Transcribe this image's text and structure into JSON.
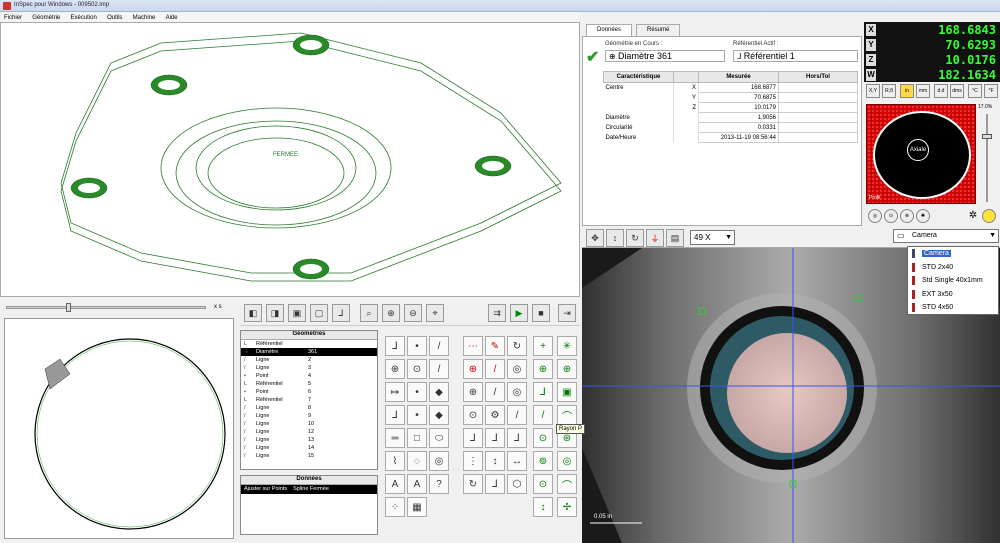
{
  "window": {
    "title": "InSpec pour Windows - 009502.imp"
  },
  "menu": [
    "Fichier",
    "Géométrie",
    "Exécution",
    "Outils",
    "Machine",
    "Aide"
  ],
  "cad": {
    "label": "FERMEE"
  },
  "profile_toolbar": {
    "scale_label": "x s"
  },
  "geometries": {
    "header": "Géométries",
    "rows": [
      {
        "icon": "L",
        "name": "Référentiel",
        "num": ""
      },
      {
        "icon": "⊕",
        "name": "Diamètre",
        "num": "361",
        "selected": true
      },
      {
        "icon": "/",
        "name": "Ligne",
        "num": "2"
      },
      {
        "icon": "/",
        "name": "Ligne",
        "num": "3"
      },
      {
        "icon": "•",
        "name": "Point",
        "num": "4"
      },
      {
        "icon": "L",
        "name": "Référentiel",
        "num": "5"
      },
      {
        "icon": "•",
        "name": "Point",
        "num": "6"
      },
      {
        "icon": "L",
        "name": "Référentiel",
        "num": "7"
      },
      {
        "icon": "/",
        "name": "Ligne",
        "num": "8"
      },
      {
        "icon": "/",
        "name": "Ligne",
        "num": "9"
      },
      {
        "icon": "/",
        "name": "Ligne",
        "num": "10"
      },
      {
        "icon": "/",
        "name": "Ligne",
        "num": "12"
      },
      {
        "icon": "/",
        "name": "Ligne",
        "num": "13"
      },
      {
        "icon": "/",
        "name": "Ligne",
        "num": "14"
      },
      {
        "icon": "/",
        "name": "Ligne",
        "num": "15"
      }
    ]
  },
  "donnees": {
    "header": "Données",
    "item1": "Ajuster sur Points",
    "item2": "Spline Fermée"
  },
  "tabs": [
    "Données",
    "Résumé"
  ],
  "data_panel": {
    "geom_label": "Géométrie en Cours :",
    "geom_value": "Diamètre 361",
    "ref_label": "Référentiel Actif :",
    "ref_value": "Référentiel 1",
    "columns": [
      "Caractéristique",
      "Mesurée",
      "Hors/Tol"
    ],
    "rows": [
      {
        "name": "Centre",
        "axis": "X",
        "value": "168.6877"
      },
      {
        "name": "",
        "axis": "Y",
        "value": "70.6875"
      },
      {
        "name": "",
        "axis": "Z",
        "value": "10.0179"
      },
      {
        "name": "Diamètre",
        "axis": "",
        "value": "1.9056"
      },
      {
        "name": "Circularité",
        "axis": "",
        "value": "0.0331"
      },
      {
        "name": "Date/Heure",
        "axis": "",
        "value": "2013-11-19 08:56:44"
      }
    ]
  },
  "dro": [
    {
      "axis": "X",
      "value": "168.6843"
    },
    {
      "axis": "Y",
      "value": "70.6293"
    },
    {
      "axis": "Z",
      "value": "10.0176"
    },
    {
      "axis": "W",
      "value": "182.1634"
    }
  ],
  "dro_tools": [
    "X,Y",
    "R,θ",
    "in",
    "mm",
    "d.d",
    "dms",
    "°C",
    "°F"
  ],
  "light": {
    "center_label": "Axiale",
    "ring_label": "Profil",
    "slider_value": "17.0%"
  },
  "camera": {
    "zoom": "49 X",
    "selected": "Camera",
    "tooltip": "Rayon P",
    "scale_label": "0.05 in",
    "options": [
      "Camera",
      "STD 2x40",
      "Std Single 40x1mm",
      "EXT 3x50",
      "STD 4x60"
    ]
  }
}
